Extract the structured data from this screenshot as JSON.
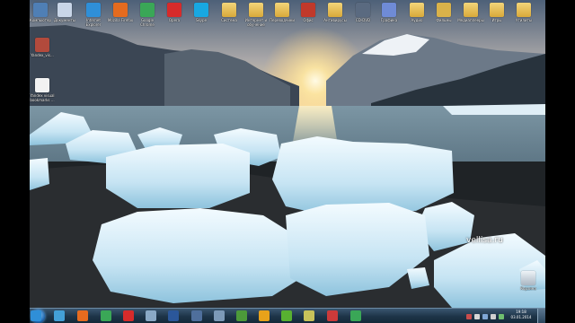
{
  "desktop": {
    "top_row": [
      {
        "id": "computer",
        "label": "Компьютер",
        "icon": "computer-icon",
        "color": "#4f7fb5"
      },
      {
        "id": "documents",
        "label": "Документы",
        "icon": "documents-icon",
        "color": "#c9d6e8"
      },
      {
        "id": "ie",
        "label": "Internet Explorer",
        "icon": "internet-explorer-icon",
        "color": "#2f8fd8"
      },
      {
        "id": "firefox",
        "label": "Mozilla Firefox",
        "icon": "firefox-icon",
        "color": "#e56b1f"
      },
      {
        "id": "chrome",
        "label": "Google Chrome",
        "icon": "chrome-icon",
        "color": "#3aa757"
      },
      {
        "id": "opera",
        "label": "Opera",
        "icon": "opera-icon",
        "color": "#d72b2b"
      },
      {
        "id": "skype",
        "label": "Skype",
        "icon": "skype-icon",
        "color": "#18a8e2"
      },
      {
        "id": "f1",
        "label": "Система",
        "icon": "folder-icon",
        "color": "#e3bd55"
      },
      {
        "id": "f2",
        "label": "Интернет и обучение",
        "icon": "folder-icon",
        "color": "#e3bd55"
      },
      {
        "id": "f3",
        "label": "Переводчики",
        "icon": "folder-icon",
        "color": "#e3bd55"
      },
      {
        "id": "f4",
        "label": "Офис",
        "icon": "office-folder-icon",
        "color": "#c0392b"
      },
      {
        "id": "f5",
        "label": "Антивирусы",
        "icon": "folder-icon",
        "color": "#e3bd55"
      },
      {
        "id": "f6",
        "label": "CD-DVD",
        "icon": "disc-folder-icon",
        "color": "#5a6a80"
      },
      {
        "id": "f7",
        "label": "Графика",
        "icon": "graphics-folder-icon",
        "color": "#6f8bd6"
      },
      {
        "id": "f8",
        "label": "Аудио",
        "icon": "folder-icon",
        "color": "#e3bd55"
      },
      {
        "id": "f9",
        "label": "Фильмы",
        "icon": "movie-folder-icon",
        "color": "#d9b24a"
      },
      {
        "id": "f10",
        "label": "Медиаплееры",
        "icon": "folder-icon",
        "color": "#e3bd55"
      },
      {
        "id": "f11",
        "label": "Игры",
        "icon": "folder-icon",
        "color": "#e3bd55"
      },
      {
        "id": "f12",
        "label": "Утилиты",
        "icon": "folder-icon",
        "color": "#e3bd55"
      }
    ],
    "left_column": [
      {
        "id": "yandex_vis",
        "label": "Yandex_vis...",
        "icon": "yandex-installer-icon",
        "color": "#b24a3c"
      },
      {
        "id": "yandex_bm",
        "label": "Yandex visual bookmarks ...",
        "icon": "text-file-icon",
        "color": "#f2f2f2"
      }
    ],
    "recycle": {
      "label": "Корзина",
      "icon": "recycle-bin-icon",
      "color": "#cfd8e0"
    },
    "watermark": "vellisa.ru"
  },
  "taskbar": {
    "pinned": [
      {
        "name": "ie",
        "icon": "internet-explorer-icon",
        "color": "#2f8fd8"
      },
      {
        "name": "ie2",
        "icon": "globe-icon",
        "color": "#43a0d8"
      },
      {
        "name": "firefox",
        "icon": "firefox-icon",
        "color": "#e56b1f"
      },
      {
        "name": "chrome",
        "icon": "chrome-icon",
        "color": "#3aa757"
      },
      {
        "name": "opera",
        "icon": "opera-icon",
        "color": "#d72b2b"
      },
      {
        "name": "explorer",
        "icon": "explorer-icon",
        "color": "#8aa9c6"
      },
      {
        "name": "word",
        "icon": "word-icon",
        "color": "#2b579a"
      },
      {
        "name": "media",
        "icon": "media-player-icon",
        "color": "#4f6f9c"
      },
      {
        "name": "calc",
        "icon": "calculator-icon",
        "color": "#7d9ab8"
      },
      {
        "name": "shield",
        "icon": "shield-icon",
        "color": "#4c9a3a"
      },
      {
        "name": "aimp",
        "icon": "audio-player-icon",
        "color": "#e8a21a"
      },
      {
        "name": "torrent",
        "icon": "torrent-icon",
        "color": "#58b131"
      },
      {
        "name": "notes",
        "icon": "notepad-icon",
        "color": "#c7c25a"
      },
      {
        "name": "paint",
        "icon": "paint-icon",
        "color": "#cc3a3a"
      },
      {
        "name": "chrome2",
        "icon": "chrome-icon",
        "color": "#3aa757"
      }
    ],
    "tray_icons": [
      {
        "icon": "network-icon",
        "color": "#c94c4c"
      },
      {
        "icon": "arrow-icon",
        "color": "#d7d7d7"
      },
      {
        "icon": "language-icon",
        "color": "#7fa7d6"
      },
      {
        "icon": "volume-icon",
        "color": "#d0d0d0"
      },
      {
        "icon": "flag-icon",
        "color": "#6fbf6f"
      }
    ],
    "clock_time": "19:18",
    "clock_date": "03.01.2014"
  }
}
